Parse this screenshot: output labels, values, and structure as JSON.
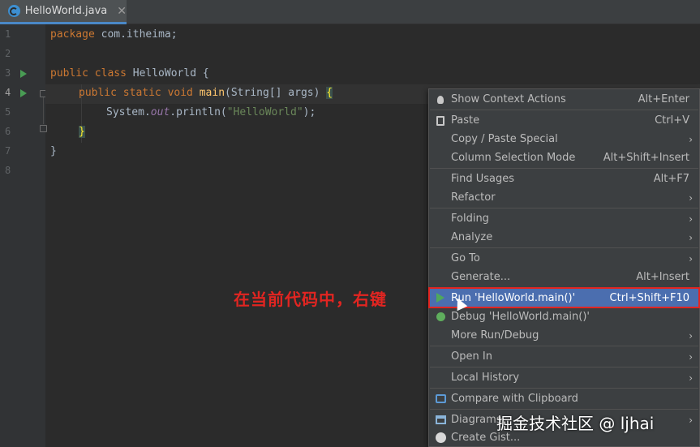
{
  "tab": {
    "filename": "HelloWorld.java",
    "close": "✕",
    "icon": "java-class-icon"
  },
  "gutter": {
    "line_numbers": [
      "1",
      "2",
      "3",
      "4",
      "5",
      "6",
      "7",
      "8"
    ]
  },
  "code": {
    "l1_kw": "package",
    "l1_rest": " com.itheima;",
    "l3_kw": "public class",
    "l3_rest": " HelloWorld {",
    "l4_kw": "public static void",
    "l4_fn": "main",
    "l4_rest": "(String[] args) ",
    "l4_brace": "{",
    "l5_a": "System.",
    "l5_out": "out",
    "l5_b": ".println(",
    "l5_str": "\"HelloWorld\"",
    "l5_c": ");",
    "l6_brace": "}",
    "l7_brace": "}"
  },
  "annotation": "在当前代码中，右键",
  "menu": {
    "items": [
      {
        "label": "Show Context Actions",
        "shortcut": "Alt+Enter",
        "icon": "bulb-icon"
      },
      {
        "label": "Paste",
        "shortcut": "Ctrl+V",
        "icon": "clipboard-icon"
      },
      {
        "label": "Copy / Paste Special",
        "submenu": "›"
      },
      {
        "label": "Column Selection Mode",
        "shortcut": "Alt+Shift+Insert"
      },
      {
        "label": "Find Usages",
        "shortcut": "Alt+F7"
      },
      {
        "label": "Refactor",
        "submenu": "›"
      },
      {
        "label": "Folding",
        "submenu": "›"
      },
      {
        "label": "Analyze",
        "submenu": "›"
      },
      {
        "label": "Go To",
        "submenu": "›"
      },
      {
        "label": "Generate...",
        "shortcut": "Alt+Insert"
      },
      {
        "label": "Run 'HelloWorld.main()'",
        "shortcut": "Ctrl+Shift+F10",
        "icon": "run-icon"
      },
      {
        "label": "Debug 'HelloWorld.main()'",
        "icon": "debug-icon"
      },
      {
        "label": "More Run/Debug",
        "submenu": "›"
      },
      {
        "label": "Open In",
        "submenu": "›"
      },
      {
        "label": "Local History",
        "submenu": "›"
      },
      {
        "label": "Compare with Clipboard",
        "icon": "compare-icon"
      },
      {
        "label": "Diagrams",
        "submenu": "›",
        "icon": "diagram-icon"
      },
      {
        "label": "Create Gist...",
        "icon": "github-icon"
      }
    ]
  },
  "watermark": "掘金技术社区 @ ljhai",
  "colors": {
    "accent": "#4b6eaf",
    "annotation": "#e22521",
    "run": "#499c54"
  }
}
